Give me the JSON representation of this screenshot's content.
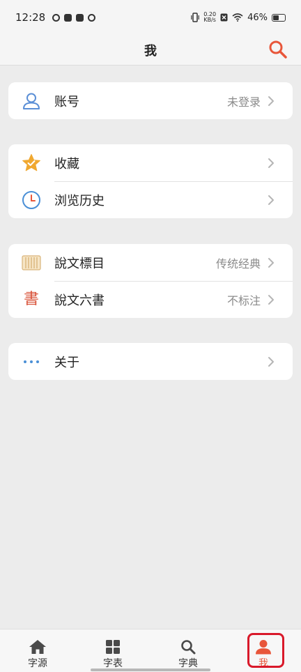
{
  "status_bar": {
    "time": "12:28",
    "net_speed_value": "0.20",
    "net_speed_unit": "KB/s",
    "battery": "46%"
  },
  "header": {
    "title": "我"
  },
  "account_card": {
    "account": {
      "label": "账号",
      "value": "未登录",
      "icon": "user-icon"
    }
  },
  "collection_card": {
    "favorites": {
      "label": "收藏",
      "icon": "star-icon"
    },
    "history": {
      "label": "浏览历史",
      "icon": "clock-icon"
    }
  },
  "shuowen_card": {
    "index": {
      "label": "說文標目",
      "value": "传统经典",
      "icon": "scroll-icon"
    },
    "six_scripts": {
      "label": "說文六書",
      "value": "不标注",
      "icon": "seal-character-icon",
      "glyph": "書"
    }
  },
  "about_card": {
    "about": {
      "label": "关于",
      "icon": "more-dots-icon"
    }
  },
  "tabbar": {
    "tabs": [
      {
        "label": "字源",
        "icon": "home-icon"
      },
      {
        "label": "字表",
        "icon": "grid-icon"
      },
      {
        "label": "字典",
        "icon": "search-icon"
      },
      {
        "label": "我",
        "icon": "person-icon",
        "active": true
      }
    ]
  },
  "colors": {
    "accent": "#e8563a",
    "highlight_border": "#d9192a",
    "user_icon": "#5b8fd6",
    "star": "#f0a830",
    "clock": "#4a8fd6",
    "dots": "#4a8fd6"
  }
}
